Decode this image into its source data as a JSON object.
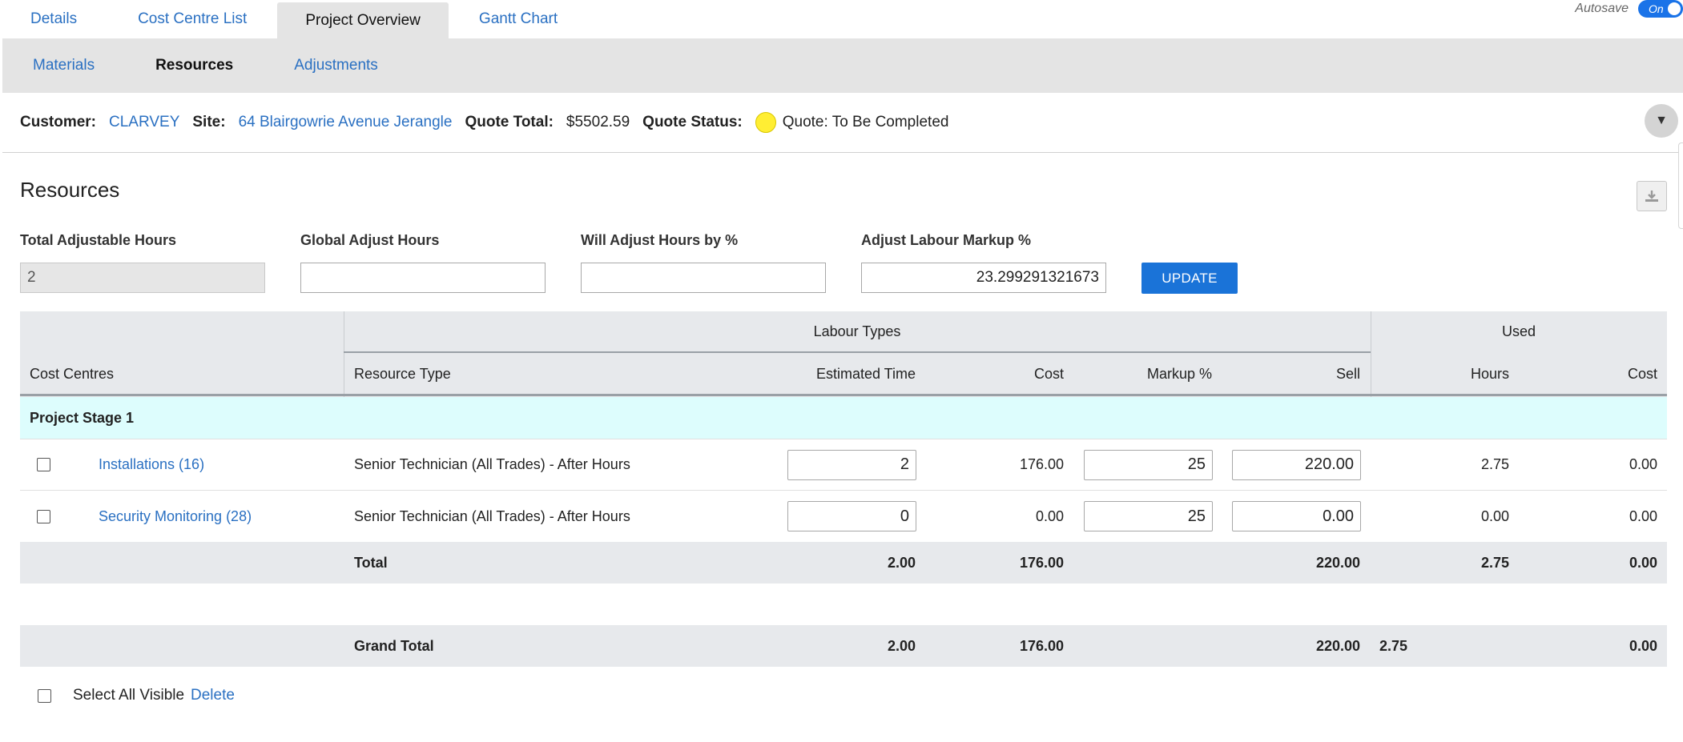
{
  "top_tabs": [
    "Details",
    "Cost Centre List",
    "Project Overview",
    "Gantt Chart"
  ],
  "autosave": {
    "label": "Autosave",
    "state": "On"
  },
  "sub_tabs": [
    "Materials",
    "Resources",
    "Adjustments"
  ],
  "info": {
    "customer_label": "Customer:",
    "customer": "CLARVEY",
    "site_label": "Site:",
    "site": "64 Blairgowrie Avenue Jerangle",
    "quote_total_label": "Quote Total:",
    "quote_total": "$5502.59",
    "quote_status_label": "Quote Status:",
    "quote_status": "Quote: To Be Completed",
    "status_color": "#ffee33"
  },
  "section_title": "Resources",
  "fields": {
    "total_adjustable_hours": {
      "label": "Total Adjustable Hours",
      "value": "2"
    },
    "global_adjust_hours": {
      "label": "Global Adjust Hours",
      "value": ""
    },
    "will_adjust_hours_pct": {
      "label": "Will Adjust Hours by %",
      "value": ""
    },
    "adjust_labour_markup": {
      "label": "Adjust Labour Markup %",
      "value": "23.299291321673"
    }
  },
  "update_label": "UPDATE",
  "table": {
    "group_headers": {
      "labour_types": "Labour Types",
      "used": "Used"
    },
    "columns": {
      "cost_centres": "Cost Centres",
      "resource_type": "Resource Type",
      "estimated_time": "Estimated Time",
      "cost": "Cost",
      "markup": "Markup %",
      "sell": "Sell",
      "used_hours": "Hours",
      "used_cost": "Cost"
    },
    "stage": "Project Stage 1",
    "rows": [
      {
        "cost_centre": "Installations (16)",
        "resource_type": "Senior Technician (All Trades) - After Hours",
        "estimated_time": "2",
        "cost": "176.00",
        "markup": "25",
        "sell": "220.00",
        "used_hours": "2.75",
        "used_cost": "0.00"
      },
      {
        "cost_centre": "Security Monitoring (28)",
        "resource_type": "Senior Technician (All Trades) - After Hours",
        "estimated_time": "0",
        "cost": "0.00",
        "markup": "25",
        "sell": "0.00",
        "used_hours": "0.00",
        "used_cost": "0.00"
      }
    ],
    "total": {
      "label": "Total",
      "estimated_time": "2.00",
      "cost": "176.00",
      "sell": "220.00",
      "used_hours": "2.75",
      "used_cost": "0.00"
    },
    "grand_total": {
      "label": "Grand Total",
      "estimated_time": "2.00",
      "cost": "176.00",
      "sell": "220.00",
      "used_hours": "2.75",
      "used_cost": "0.00"
    }
  },
  "footer": {
    "select_all": "Select All Visible",
    "delete": "Delete"
  },
  "colors": {
    "link": "#2a70c2",
    "primary": "#1a73d8",
    "header_bg": "#e7e9ec",
    "stage_bg": "#ddfdfd"
  }
}
